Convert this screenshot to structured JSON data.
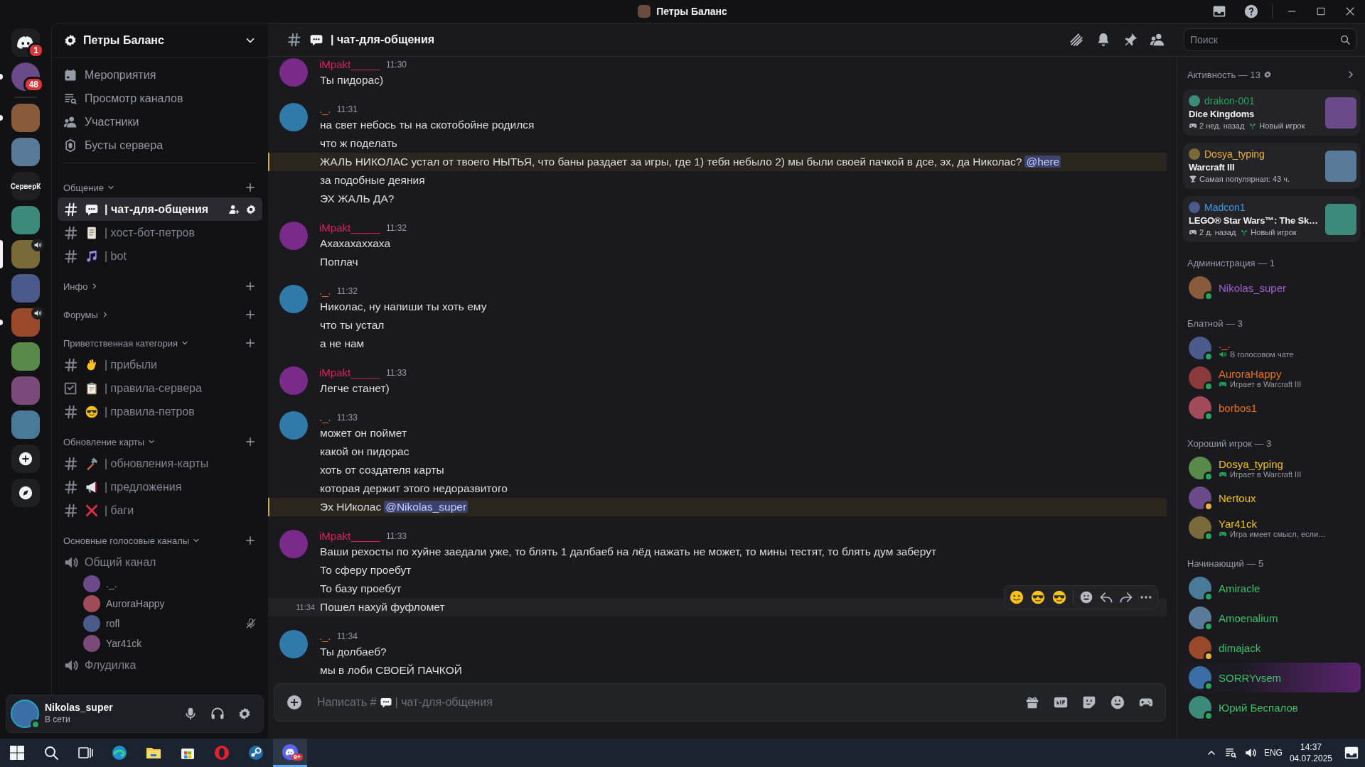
{
  "window": {
    "title": "Петры Баланс"
  },
  "servers": [
    {
      "kind": "home",
      "selected": false,
      "unread": false,
      "badge": "1"
    },
    {
      "kind": "dm",
      "selected": false,
      "unread": true,
      "badge": "48"
    },
    {
      "kind": "image",
      "selected": false,
      "unread": true
    },
    {
      "kind": "image",
      "selected": false,
      "unread": false
    },
    {
      "kind": "text",
      "label": "СерверК",
      "selected": false,
      "unread": false
    },
    {
      "kind": "image",
      "selected": false,
      "unread": false
    },
    {
      "kind": "image",
      "selected": true,
      "unread": false,
      "voice": true
    },
    {
      "kind": "image",
      "selected": false,
      "unread": false
    },
    {
      "kind": "image",
      "selected": false,
      "unread": true,
      "voice": true
    },
    {
      "kind": "image",
      "selected": false,
      "unread": false
    },
    {
      "kind": "image",
      "selected": false,
      "unread": false
    },
    {
      "kind": "image",
      "selected": false,
      "unread": false
    },
    {
      "kind": "add",
      "selected": false,
      "unread": false
    },
    {
      "kind": "explore",
      "selected": false,
      "unread": false
    }
  ],
  "server_header": {
    "name": "Петры Баланс"
  },
  "nav_items": [
    {
      "kind": "events",
      "label": "Мероприятия"
    },
    {
      "kind": "browse",
      "label": "Просмотр каналов"
    },
    {
      "kind": "members",
      "label": "Участники"
    },
    {
      "kind": "boosts",
      "label": "Бусты сервера"
    }
  ],
  "categories": [
    {
      "name": "Общение",
      "expanded": true,
      "channels": [
        {
          "kind": "text",
          "name": "| чат-для-общения",
          "selected": true
        },
        {
          "kind": "text",
          "name": "| хост-бот-петров",
          "selected": false
        },
        {
          "kind": "text",
          "name": "| bot",
          "selected": false
        }
      ]
    },
    {
      "name": "Инфо",
      "expanded": false
    },
    {
      "name": "Форумы",
      "expanded": false
    },
    {
      "name": "Приветственная категория",
      "expanded": true,
      "channels": [
        {
          "kind": "text",
          "name": "| прибыли",
          "selected": false
        },
        {
          "kind": "rules",
          "name": "| правила-сервера",
          "selected": false
        },
        {
          "kind": "text",
          "name": "| правила-петров",
          "selected": false
        }
      ]
    },
    {
      "name": "Обновление карты",
      "expanded": true,
      "channels": [
        {
          "kind": "text",
          "name": "| обновления-карты",
          "selected": false
        },
        {
          "kind": "text",
          "name": "| предложения",
          "selected": false
        },
        {
          "kind": "text",
          "name": "| баги",
          "selected": false
        }
      ]
    },
    {
      "name": "Основные голосовые каналы",
      "expanded": true,
      "channels": [
        {
          "kind": "voice",
          "name": "Общий канал",
          "selected": false,
          "users": [
            {
              "name": "._.",
              "muted": false
            },
            {
              "name": "AuroraHappy",
              "muted": false
            },
            {
              "name": "rofl",
              "muted": true
            },
            {
              "name": "Yar41ck",
              "muted": false
            }
          ]
        },
        {
          "kind": "voice",
          "name": "Флудилка",
          "selected": false
        }
      ]
    }
  ],
  "user_panel": {
    "name": "Nikolas_super",
    "status_text": "В сети",
    "idle": false
  },
  "chat": {
    "channel": "| чат-для-общения",
    "messages": [
      {
        "author": "iMpakt_____",
        "color": "#d9245b",
        "time": "11:30",
        "lines": [
          {
            "kind": "plain",
            "text": "Ты пидорас)"
          }
        ]
      },
      {
        "author": "._.",
        "color": "#e8711c",
        "time": "11:31",
        "lines": [
          {
            "kind": "plain",
            "text": "на свет небось ты на скотобойне родился"
          },
          {
            "kind": "plain",
            "text": "что ж поделать"
          },
          {
            "kind": "mention",
            "text": "ЖАЛЬ НИКОЛАС устал от твоего НЫТЬЯ, что баны раздает за игры, где 1) тебя небыло 2) мы были своей пачкой в дсе, эх, да Николас?",
            "mention": "@here"
          },
          {
            "kind": "plain",
            "text": "за подобные деяния"
          },
          {
            "kind": "plain",
            "text": "ЭХ ЖАЛЬ ДА?"
          }
        ]
      },
      {
        "author": "iMpakt_____",
        "color": "#d9245b",
        "time": "11:32",
        "lines": [
          {
            "kind": "plain",
            "text": "Ахахахаххаха"
          },
          {
            "kind": "plain",
            "text": "Поплач"
          }
        ]
      },
      {
        "author": "._.",
        "color": "#e8711c",
        "time": "11:32",
        "lines": [
          {
            "kind": "plain",
            "text": "Николас, ну напиши ты хоть ему"
          },
          {
            "kind": "plain",
            "text": "что ты устал"
          },
          {
            "kind": "plain",
            "text": "а не нам"
          }
        ]
      },
      {
        "author": "iMpakt_____",
        "color": "#d9245b",
        "time": "11:33",
        "lines": [
          {
            "kind": "plain",
            "text": "Легче станет)"
          }
        ]
      },
      {
        "author": "._.",
        "color": "#e8711c",
        "time": "11:33",
        "lines": [
          {
            "kind": "plain",
            "text": "может он поймет"
          },
          {
            "kind": "plain",
            "text": "какой он пидорас"
          },
          {
            "kind": "plain",
            "text": "хоть от создателя карты"
          },
          {
            "kind": "plain",
            "text": "которая держит этого недоразвитого"
          },
          {
            "kind": "mention",
            "text": "Эх НИколас",
            "mention": "@Nikolas_super"
          }
        ]
      },
      {
        "author": "iMpakt_____",
        "color": "#d9245b",
        "time": "11:33",
        "lines": [
          {
            "kind": "plain",
            "text": "Ваши рехосты по хуйне заедали уже, то блять 1 далбаеб на лёд нажать не может, то мины тестят, то блять дум заберут"
          },
          {
            "kind": "plain",
            "text": "То сферу проебут"
          },
          {
            "kind": "plain",
            "text": "То базу проебут"
          },
          {
            "kind": "hover",
            "text": "Пошел нахуй фуфломет",
            "time": "11:34"
          }
        ]
      },
      {
        "author": "._.",
        "color": "#e8711c",
        "time": "11:34",
        "lines": [
          {
            "kind": "plain",
            "text": "Ты долбаеб?"
          },
          {
            "kind": "plain",
            "text": "мы в лоби СВОЕЙ ПАЧКОЙ"
          }
        ]
      }
    ],
    "input": {
      "placeholder": "Написать #",
      "placeholder_channel": "| чат-для-общения"
    }
  },
  "search": {
    "placeholder": "Поиск"
  },
  "activity": {
    "title": "Активность — 13",
    "cards": [
      {
        "user": "drakon-001",
        "color": "#23a55a",
        "game": "Dice Kingdoms",
        "meta": [
          {
            "kind": "time",
            "text": "2 нед. назад"
          },
          {
            "kind": "new",
            "text": "Новый игрок"
          }
        ]
      },
      {
        "user": "Dosya_typing",
        "color": "#f0b232",
        "game": "Warcraft III",
        "meta": [
          {
            "kind": "trophy",
            "text": "Самая популярная: 43 ч."
          }
        ]
      },
      {
        "user": "Madcon1",
        "color": "#3d9be9",
        "game": "LEGO® Star Wars™: The Sk…",
        "meta": [
          {
            "kind": "time",
            "text": "2 д. назад"
          },
          {
            "kind": "new",
            "text": "Новый игрок"
          }
        ]
      }
    ]
  },
  "member_groups": [
    {
      "title": "Администрация — 1",
      "members": [
        {
          "name": "Nikolas_super",
          "color": "#a55fd0",
          "idle": false,
          "nameplate": false
        }
      ]
    },
    {
      "title": "Блатной — 3",
      "members": [
        {
          "name": "._.",
          "color": "#e8711c",
          "idle": false,
          "activity": {
            "kind": "voice",
            "text": "В голосовом чате"
          },
          "nameplate": false
        },
        {
          "name": "AuroraHappy",
          "color": "#e8711c",
          "idle": false,
          "activity": {
            "kind": "game",
            "text": "Играет в Warcraft III"
          },
          "nameplate": false
        },
        {
          "name": "borbos1",
          "color": "#e8711c",
          "idle": false,
          "nameplate": false
        }
      ]
    },
    {
      "title": "Хороший игрок — 3",
      "members": [
        {
          "name": "Dosya_typing",
          "color": "#f0c419",
          "idle": false,
          "activity": {
            "kind": "game",
            "text": "Играет в Warcraft III"
          },
          "nameplate": false
        },
        {
          "name": "Nertoux",
          "color": "#f0c419",
          "idle": true,
          "nameplate": false
        },
        {
          "name": "Yar41ck",
          "color": "#f0c419",
          "idle": false,
          "activity": {
            "kind": "game",
            "text": "Игра имеет смысл, если…"
          },
          "nameplate": false
        }
      ]
    },
    {
      "title": "Начинающий — 5",
      "members": [
        {
          "name": "Amiracle",
          "color": "#3cc26a",
          "idle": false,
          "nameplate": false
        },
        {
          "name": "Amoenalium",
          "color": "#3cc26a",
          "idle": false,
          "nameplate": false
        },
        {
          "name": "dimajack",
          "color": "#3cc26a",
          "idle": true,
          "nameplate": false
        },
        {
          "name": "SORRYvsem",
          "color": "#3cc26a",
          "idle": false,
          "nameplate": true
        },
        {
          "name": "Юрий Беспалов",
          "color": "#3cc26a",
          "idle": false,
          "nameplate": false
        }
      ]
    }
  ],
  "taskbar": {
    "apps": [
      {
        "kind": "start",
        "selected": false
      },
      {
        "kind": "search",
        "selected": false
      },
      {
        "kind": "taskview",
        "selected": false
      },
      {
        "kind": "edge",
        "selected": false
      },
      {
        "kind": "files",
        "selected": false
      },
      {
        "kind": "store",
        "selected": false
      },
      {
        "kind": "opera",
        "selected": false
      },
      {
        "kind": "steam",
        "selected": false
      },
      {
        "kind": "discord",
        "selected": true,
        "badge": "9+"
      }
    ],
    "language": "ENG",
    "time": "14:37",
    "date": "04.07.2025"
  }
}
